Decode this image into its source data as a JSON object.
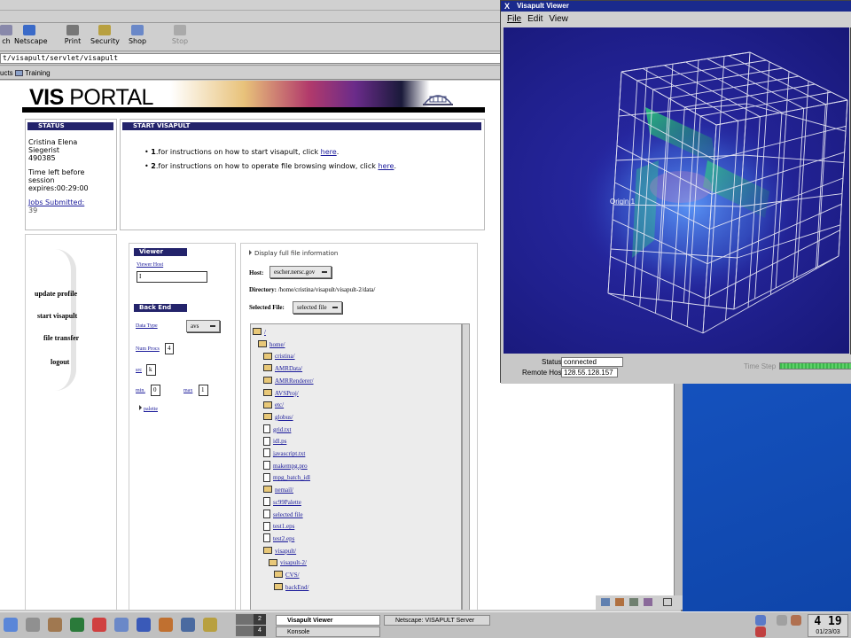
{
  "browser": {
    "toolbar": {
      "search": "ch",
      "netscape": "Netscape",
      "print": "Print",
      "security": "Security",
      "shop": "Shop",
      "stop": "Stop"
    },
    "location": "t/visapult/servlet/visapult",
    "personal_bar": {
      "products": "ucts",
      "training": "Training"
    }
  },
  "portal": {
    "logo_bold": "VIS",
    "logo_light": " PORTAL",
    "status": {
      "header": "STATUS",
      "name1": "Cristina Elena",
      "name2": "Siegerist",
      "id": "490385",
      "time_left1": "Time left before",
      "time_left2": "session",
      "expires": "expires:00:29:00",
      "jobs_label": "Jobs Submitted:",
      "jobs_count": "39"
    },
    "start": {
      "header": "START VISAPULT",
      "item1_num": "1",
      "item1_text": "for instructions on how to start visapult, click ",
      "item1_link": "here",
      "item2_num": "2",
      "item2_text": "for instructions on how to operate file browsing window, click ",
      "item2_link": "here"
    },
    "nav": {
      "update": "update profile",
      "start": "start visapult",
      "transfer": "file transfer",
      "logout": "logout"
    },
    "viewer": {
      "header": "Viewer",
      "host_label": "Viewer Host",
      "host_value": "I",
      "backend_header": "Back End",
      "datatype_label": "Data Type",
      "datatype_value": "avs",
      "numprocs_label": "Num Procs",
      "numprocs_value": "4",
      "src_label": "src",
      "src_value": "k",
      "min_label": "min.",
      "min_value": "0",
      "max_label": "max",
      "max_value": "1",
      "palette_label": "palette"
    },
    "files": {
      "display_full": "Display full file information",
      "host_label": "Host:",
      "host_value": "escher.nersc.gov",
      "directory_label": "Directory:",
      "directory_value": "/home/cristina/visapult/visapult-2/data/",
      "selected_label": "Selected File:",
      "selected_value": "selected file",
      "tree": [
        {
          "name": "/",
          "type": "folder",
          "depth": 0
        },
        {
          "name": "home/",
          "type": "folder",
          "depth": 1
        },
        {
          "name": "cristina/",
          "type": "folder",
          "depth": 2
        },
        {
          "name": "AMRData/",
          "type": "folder",
          "depth": 2
        },
        {
          "name": "AMRRenderer/",
          "type": "folder",
          "depth": 2
        },
        {
          "name": "AVSProj/",
          "type": "folder",
          "depth": 2
        },
        {
          "name": "etc/",
          "type": "folder",
          "depth": 2
        },
        {
          "name": "globus/",
          "type": "folder",
          "depth": 2
        },
        {
          "name": "grid.txt",
          "type": "file",
          "depth": 2
        },
        {
          "name": "idl.ps",
          "type": "file",
          "depth": 2
        },
        {
          "name": "javascript.txt",
          "type": "file",
          "depth": 2
        },
        {
          "name": "makempg.pro",
          "type": "file",
          "depth": 2
        },
        {
          "name": "mpg_batch_idl",
          "type": "file",
          "depth": 2
        },
        {
          "name": "nemail/",
          "type": "folder",
          "depth": 2
        },
        {
          "name": "sc99Palette",
          "type": "file",
          "depth": 2
        },
        {
          "name": "selected file",
          "type": "file",
          "depth": 2
        },
        {
          "name": "test1.eps",
          "type": "file",
          "depth": 2
        },
        {
          "name": "test2.eps",
          "type": "file",
          "depth": 2
        },
        {
          "name": "visapult/",
          "type": "folder",
          "depth": 2
        },
        {
          "name": "visapult-2/",
          "type": "folder",
          "depth": 3
        },
        {
          "name": "CVS/",
          "type": "folder",
          "depth": 4
        },
        {
          "name": "backEnd/",
          "type": "folder",
          "depth": 4
        }
      ]
    }
  },
  "visapult": {
    "title": "Visapult Viewer",
    "menu": {
      "file": "File",
      "edit": "Edit",
      "view": "View"
    },
    "origin_label": "Origin.1",
    "status_label": "Status",
    "status_value": "connected",
    "remote_label": "Remote Host",
    "remote_value": "128.55.128.157",
    "timestep_label": "Time Step"
  },
  "taskbar": {
    "pager": [
      "2",
      "4"
    ],
    "task1": "Visapult Viewer",
    "task2": "Netscape: VISAPULT Server",
    "task3": "Konsole",
    "clock": "4 19",
    "date": "01/23/03"
  }
}
